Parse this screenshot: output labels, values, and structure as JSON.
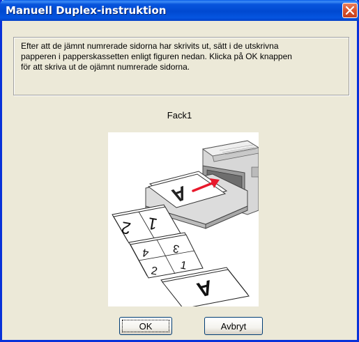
{
  "window": {
    "title": "Manuell Duplex-instruktion"
  },
  "message": {
    "lines": [
      "Efter att de jämnt numrerade sidorna har skrivits ut, sätt i de utskrivna",
      "papperen i papperskassetten enligt figuren nedan. Klicka på OK knappen",
      "för att skriva ut de ojämnt numrerade sidorna."
    ]
  },
  "tray": {
    "label": "Fack1"
  },
  "figure": {
    "page_numbers": [
      "2",
      "1",
      "4",
      "3",
      "2",
      "1"
    ],
    "stack_letter": "A",
    "tray_letter": "A"
  },
  "buttons": {
    "ok_label": "OK",
    "cancel_label": "Avbryt"
  },
  "colors": {
    "titlebar": "#0054e3",
    "window_bg": "#ece9d8",
    "close_button": "#d9532c",
    "arrow": "#e8192c"
  }
}
